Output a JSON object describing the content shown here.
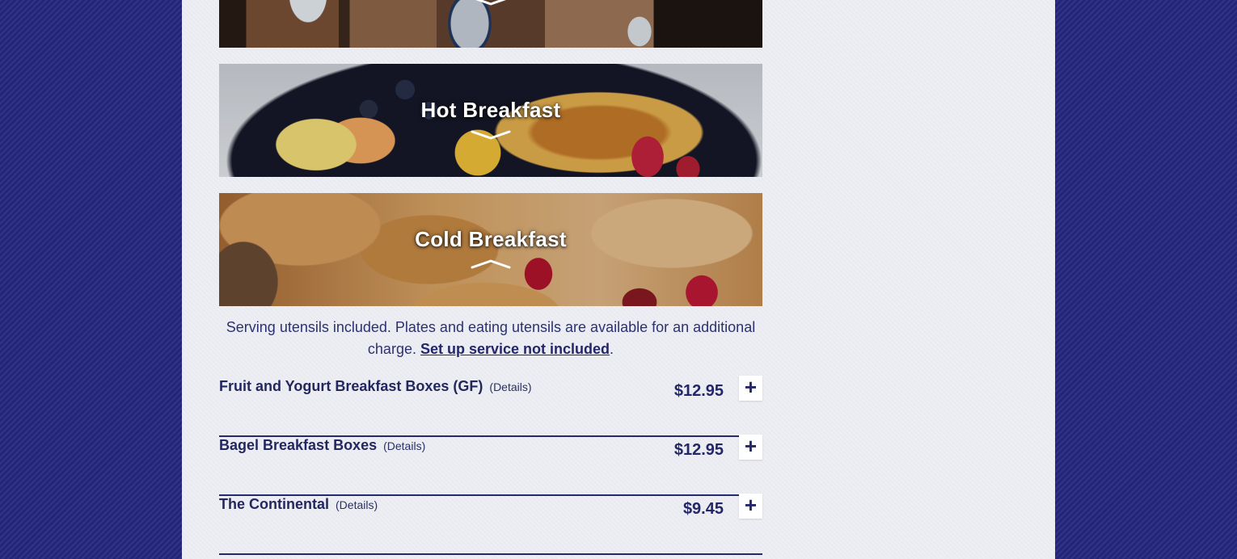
{
  "categories": [
    {
      "title": "",
      "expanded": false
    },
    {
      "title": "Hot Breakfast",
      "expanded": false
    },
    {
      "title": "Cold Breakfast",
      "expanded": true
    }
  ],
  "cold_breakfast": {
    "intro_text": "Serving utensils included. Plates and eating utensils are available for an additional charge.",
    "intro_link": "Set up service not included",
    "intro_end": ".",
    "items": [
      {
        "name": "Fruit and Yogurt Breakfast Boxes (GF)",
        "details": "(Details)",
        "price": "$12.95",
        "add": "+"
      },
      {
        "name": "Bagel Breakfast Boxes",
        "details": "(Details)",
        "price": "$12.95",
        "add": "+"
      },
      {
        "name": "The Continental",
        "details": "(Details)",
        "price": "$9.45",
        "add": "+"
      }
    ]
  },
  "colors": {
    "background": "#23257a",
    "panel": "#eceef3",
    "text": "#23266a"
  }
}
